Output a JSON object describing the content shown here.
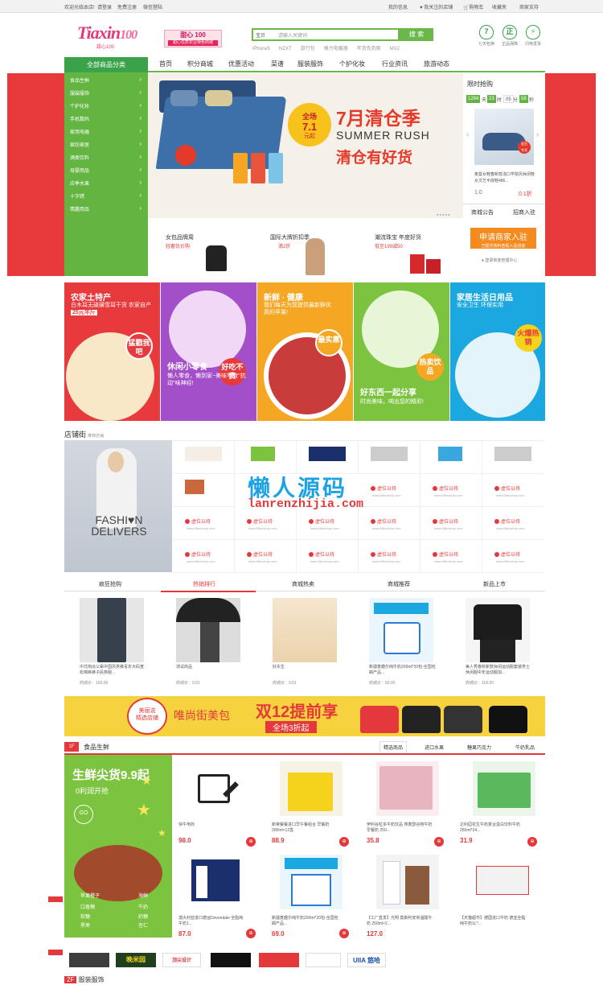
{
  "topbar": {
    "welcome": "欢迎光临本店!",
    "login": "请登录",
    "register": "免费注册",
    "wechat_login": "微信登陆",
    "my_info": "我的信息",
    "favorite_shop": "我关注的店铺",
    "cart": "购物车",
    "favorites": "收藏夹",
    "merchant_support": "商家支持"
  },
  "header": {
    "logo_text": "Tiaxin",
    "logo_num": "100",
    "logo_sub": "甜心100",
    "promo_title": "甜心 100",
    "promo_sub": "甜心优质农业特色商城",
    "search_category": "宝贝",
    "search_placeholder": "请输入关键词",
    "search_button": "搜 索",
    "hot_words": [
      "iPhone5",
      "NZXT",
      "旅行包",
      "格力电暖器",
      "年货先到家",
      "MX2"
    ],
    "badges": [
      {
        "icon": "7",
        "label": "七天包换"
      },
      {
        "icon": "正",
        "label": "正品保障"
      },
      {
        "icon": "⚡",
        "label": "闪电发货"
      }
    ]
  },
  "nav": {
    "all_categories": "全部商品分类",
    "items": [
      "首页",
      "积分商城",
      "优惠活动",
      "菜谱",
      "服装服饰",
      "个护化妆",
      "行业资讯",
      "旅游动态"
    ]
  },
  "sidebar": {
    "items": [
      "食品生鲜",
      "服装服饰",
      "个护化妆",
      "手机数码",
      "家用电器",
      "家纺家居",
      "酒类饮料",
      "母婴用品",
      "应季水果",
      "十字绣",
      "情趣用品"
    ]
  },
  "banner": {
    "circle_line1": "全场",
    "circle_line2": "7.1",
    "circle_line3": "元起",
    "title": "7月清仓季",
    "subtitle": "SUMMER RUSH",
    "title2": "清仓有好货"
  },
  "subpromos": [
    {
      "title": "女包品牌周",
      "sub": "轻奢优价购"
    },
    {
      "title": "国际大牌折扣季",
      "sub": "満2折"
    },
    {
      "title": "潮流珠宝 年度好货",
      "sub": "低至199减50"
    }
  ],
  "flash_sale": {
    "title": "限时抢购",
    "timer": [
      "1294",
      "23",
      "05",
      "58"
    ],
    "timer_units": [
      "天",
      "时",
      "分",
      "秒"
    ],
    "product_desc": "麦曼女鞋春新款浅口学院风休闲鞋女文艺平底鞋486...",
    "price_old": "1.0",
    "price_new": "0.1折",
    "tab_notice": "商城公告",
    "tab_recruit": "招商入驻",
    "join_button": "申请商家入驻",
    "join_sub": "已提交资料查看入驻进度",
    "login_link": "登录商家管理中心"
  },
  "tiles": [
    {
      "title": "农家土特产",
      "sub": "白木耳无硫磺雪耳干货 农家自产",
      "price": "25元半斤",
      "tag": "猛戳我吧",
      "color": "#e8393c"
    },
    {
      "title": "休闲小零食",
      "sub": "懒人零食，懒到家~美味零食\"抗动\"味神经!",
      "tag": "好吃不贵",
      "color": "#a34fc9"
    },
    {
      "title": "新鲜 · 健康",
      "sub": "我们每天为您提供最新鲜优质的苹果!",
      "tag": "最实惠",
      "color": "#f5a623"
    },
    {
      "title": "好东西一起分享",
      "sub": "时尚美味，喝出您的精彩!",
      "tag": "热卖饮品",
      "color": "#7cc33f"
    },
    {
      "title": "家居生活日用品",
      "sub": "安全卫生 环保实用",
      "tag": "火爆热销",
      "color": "#1ba8e0"
    }
  ],
  "shop_street": {
    "title": "店铺街",
    "sub": "推荐店铺",
    "fashion_text1": "FASHI♥N",
    "fashion_text2": "DELIVERS",
    "vacant": "虚位以待",
    "vacant_url": "www.68ecshop.com",
    "watermark1": "懒人源码",
    "watermark2": "lanrenzhijia.com"
  },
  "product_tabs": {
    "tabs": [
      "疯狂抢购",
      "热销排行",
      "商城热卖",
      "商城推荐",
      "新品上市"
    ],
    "active": 1,
    "items": [
      {
        "name": "中式南派父辈中国风男裤青年大码宽松棉麻裤子民族服...",
        "price_label": "商城价：",
        "price": "100.00"
      },
      {
        "name": "测试商品",
        "price_label": "商城价：",
        "price": "0.01"
      },
      {
        "name": "好东生",
        "price_label": "商城价：",
        "price": "0.01"
      },
      {
        "name": "新疆麦趣尔纯牛奶200ml*20包-全国包邮产品...",
        "price_label": "商城价：",
        "price": "69.00"
      },
      {
        "name": "美人秀春秋新款休闲运动服套装男士休闲服中年运动服加...",
        "price_label": "商城价：",
        "price": "118.00"
      }
    ]
  },
  "ad_banner": {
    "circle_top": "美丽说",
    "circle_bottom": "精选店铺",
    "text1": "唯尚街美包",
    "text2": "双12提前享",
    "text3": "全场3折起"
  },
  "food_floor": {
    "num": "1F",
    "title": "食品生鲜",
    "tabs": [
      "精选商品",
      "进口水果",
      "糖果巧克力",
      "牛奶乳品"
    ],
    "promo_title": "生鲜尖货9.9起",
    "promo_sub": "0利润开抢",
    "go": "GO",
    "keywords": [
      "苹果橙子",
      "海鲜",
      "口香糖",
      "牛奶",
      "软糖",
      "奶糖",
      "黑枣",
      "杏仁"
    ],
    "items": [
      {
        "name": "快牛电商",
        "price": "98.0"
      },
      {
        "name": "新荣餐餐进口早午餐组合 早餐奶200ml×12盒",
        "price": "88.9"
      },
      {
        "name": "伊利谷粒多牛奶饮品 燕麦醇谷物牛奶早餐奶 250...",
        "price": "35.8"
      },
      {
        "name": "达利园花生牛奶复合蛋白饮料牛奶250ml*24...",
        "price": "31.9"
      },
      {
        "name": "澳大利亚进口德运Devondale 全脂纯牛奶1...",
        "price": "87.0"
      },
      {
        "name": "新疆麦趣尔纯牛奶200ml*20包-全国包邮产品...",
        "price": "69.0"
      },
      {
        "name": "【工厂直发】光明 莫斯利安常温酸牛奶 250ml×2...",
        "price": "127.0"
      },
      {
        "name": "【天猫超市】德国进口牛奶 德亚全脂纯牛奶1L*...",
        "price": ""
      }
    ]
  },
  "brand_logos": [
    "",
    "晚米园",
    "顶尖设计",
    "",
    "",
    "",
    "UIIA 悠哈"
  ],
  "next_floor": "服装服饰",
  "colors": {
    "green": "#3aa34a",
    "red": "#e4393c",
    "hero_red": "#e8393c"
  }
}
